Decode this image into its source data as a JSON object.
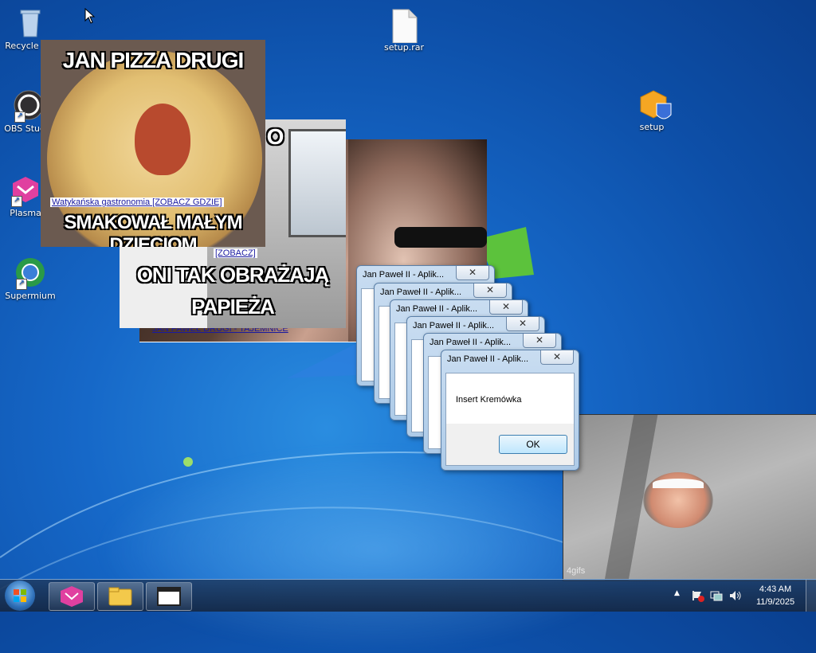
{
  "desktop": {
    "icons": [
      {
        "label": "Recycle Bin"
      },
      {
        "label": "OBS Studio"
      },
      {
        "label": "Plasma"
      },
      {
        "label": "Supermium"
      },
      {
        "label": "setup.rar"
      },
      {
        "label": "setup"
      }
    ]
  },
  "memes": {
    "pizza": {
      "top_text": "JAN PIZZA DRUGI",
      "bottom_text": "SMAKOWAŁ MAŁYM DZIECIOM",
      "link": "Watykańska gastronomia [ZOBACZ GDZIE]"
    },
    "computer": {
      "corner_text": "O",
      "link": "[ZOBACZ]",
      "line1": "ONI TAK OBRAŻAJĄ",
      "line2": "PAPIEŻA"
    },
    "dark": {
      "link": "JAN PAWEŁ DRUGI - TAJEMNICE"
    },
    "gif": {
      "watermark": "4gifs"
    }
  },
  "dialogs": {
    "title": "Jan Paweł II - Aplik...",
    "close": "✕",
    "message": "Insert Kremówka",
    "ok_label": "OK"
  },
  "taskbar": {
    "time": "4:43 AM",
    "date": "11/9/2025",
    "tray_arrow": "▲"
  },
  "colors": {
    "desktop_blue": "#1668c8",
    "taskbar": "#1e3c64",
    "link_blue": "#1a1aa0"
  }
}
